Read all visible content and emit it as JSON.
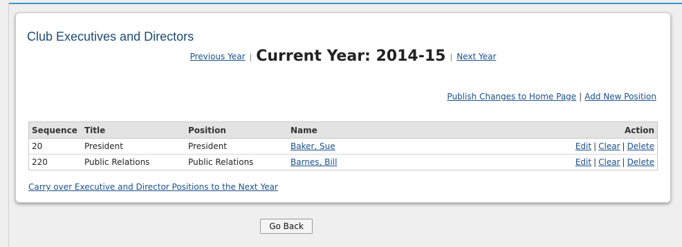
{
  "page": {
    "title": "Club Executives and Directors",
    "previous_year": "Previous Year",
    "current_year": "Current Year: 2014-15",
    "next_year": "Next Year",
    "year_separator": "|"
  },
  "actions": {
    "publish": "Publish Changes to Home Page",
    "separator": "|",
    "add_position": "Add New Position"
  },
  "table": {
    "headers": {
      "sequence": "Sequence",
      "title": "Title",
      "position": "Position",
      "name": "Name",
      "action": "Action"
    },
    "rows": [
      {
        "sequence": "20",
        "title": "President",
        "position": "President",
        "name": "Baker, Sue",
        "edit": "Edit",
        "clear": "Clear",
        "delete": "Delete"
      },
      {
        "sequence": "220",
        "title": "Public Relations",
        "position": "Public Relations",
        "name": "Barnes, Bill",
        "edit": "Edit",
        "clear": "Clear",
        "delete": "Delete"
      }
    ],
    "action_separator": "|"
  },
  "carry_over": "Carry over Executive and Director Positions to the Next Year",
  "go_back": "Go Back",
  "colors": {
    "accent_rule": "#3a93c9",
    "title": "#1d4a77",
    "link": "#1a4f8a",
    "header_bg": "#e3e3e3"
  }
}
